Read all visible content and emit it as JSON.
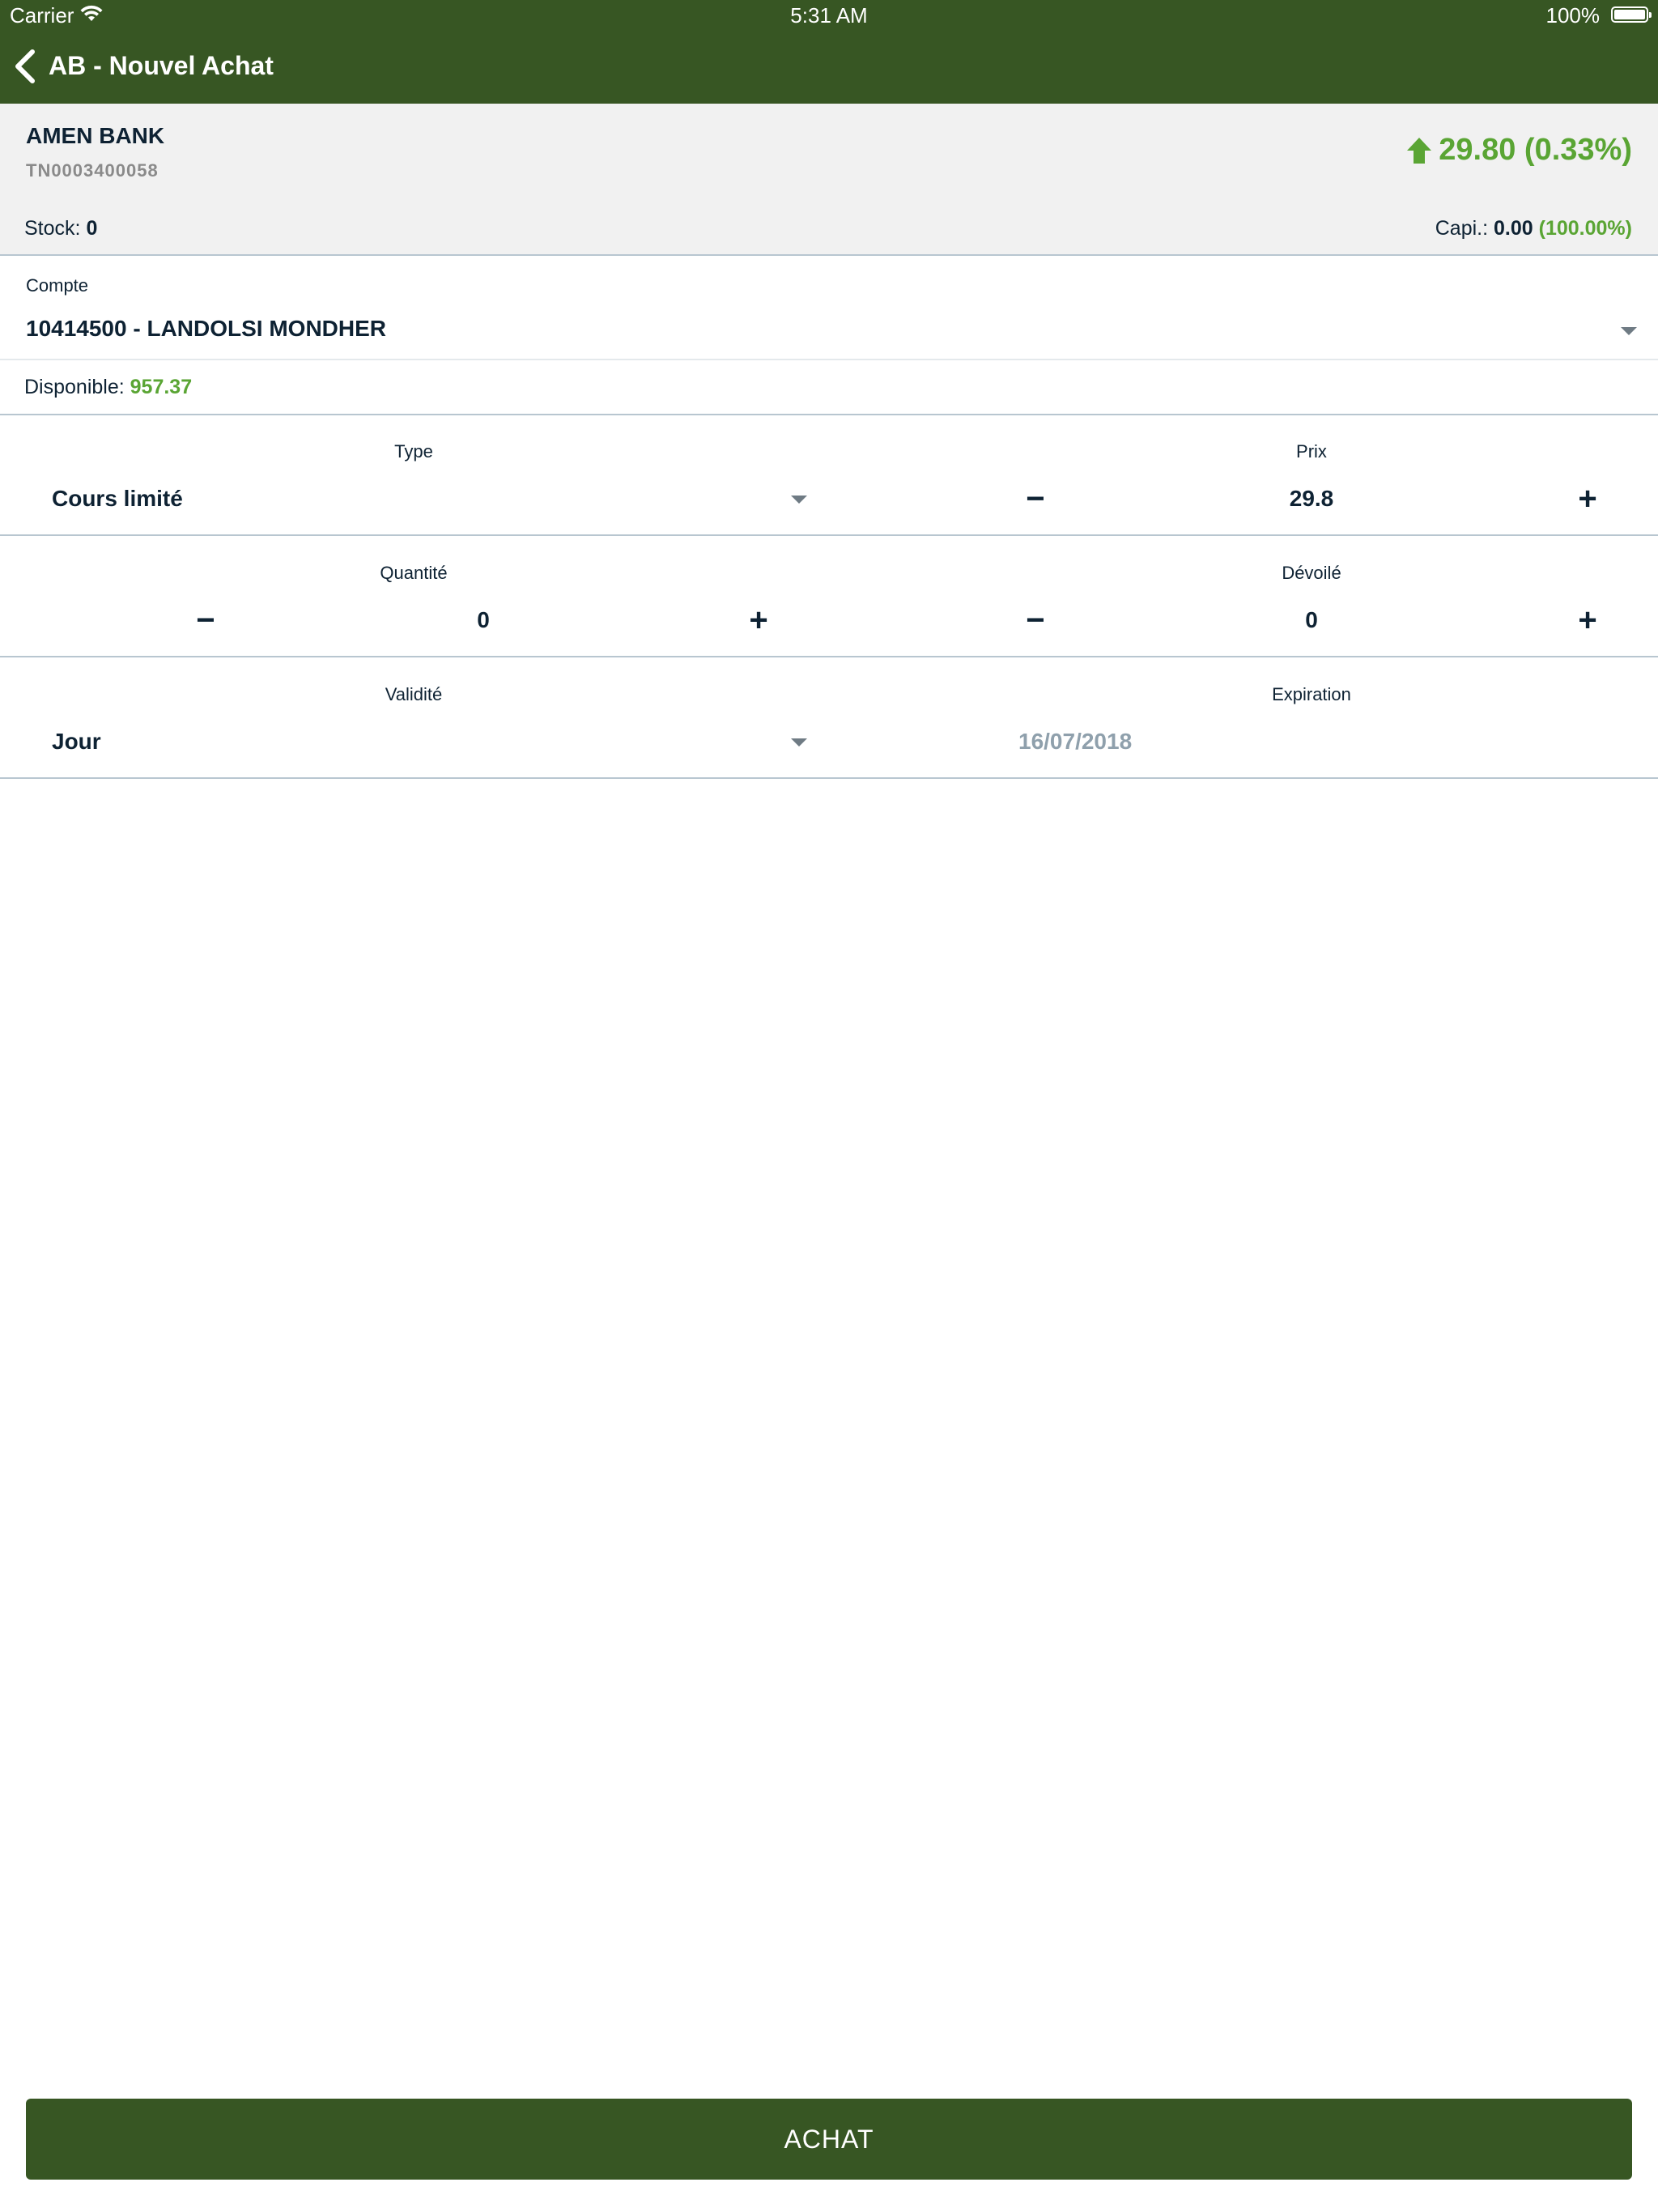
{
  "status_bar": {
    "carrier": "Carrier",
    "time": "5:31 AM",
    "battery": "100%"
  },
  "nav": {
    "title": "AB - Nouvel Achat"
  },
  "stock": {
    "name": "AMEN BANK",
    "isin": "TN0003400058",
    "price_change": "29.80 (0.33%)",
    "trend": "up",
    "stock_label": "Stock:",
    "stock_value": "0",
    "capi_label": "Capi.:",
    "capi_value": "0.00",
    "capi_pct": "(100.00%)"
  },
  "account": {
    "label": "Compte",
    "value": "10414500 - LANDOLSI MONDHER",
    "available_label": "Disponible:",
    "available_value": "957.37"
  },
  "form": {
    "type": {
      "label": "Type",
      "value": "Cours limité"
    },
    "prix": {
      "label": "Prix",
      "value": "29.8",
      "minus": "−",
      "plus": "+"
    },
    "quantite": {
      "label": "Quantité",
      "value": "0",
      "minus": "−",
      "plus": "+"
    },
    "devoile": {
      "label": "Dévoilé",
      "value": "0",
      "minus": "−",
      "plus": "+"
    },
    "validite": {
      "label": "Validité",
      "value": "Jour"
    },
    "expiration": {
      "label": "Expiration",
      "value": "16/07/2018"
    }
  },
  "actions": {
    "submit_label": "ACHAT"
  },
  "colors": {
    "primary": "#375623",
    "positive": "#5aa534",
    "text": "#0e2233",
    "muted": "#8a8a8a",
    "disabled": "#8fa0ac"
  },
  "icons": {
    "back": "chevron-left-icon",
    "trend": "arrow-up-icon",
    "dropdown": "caret-down-icon",
    "wifi": "wifi-icon",
    "battery": "battery-icon"
  }
}
